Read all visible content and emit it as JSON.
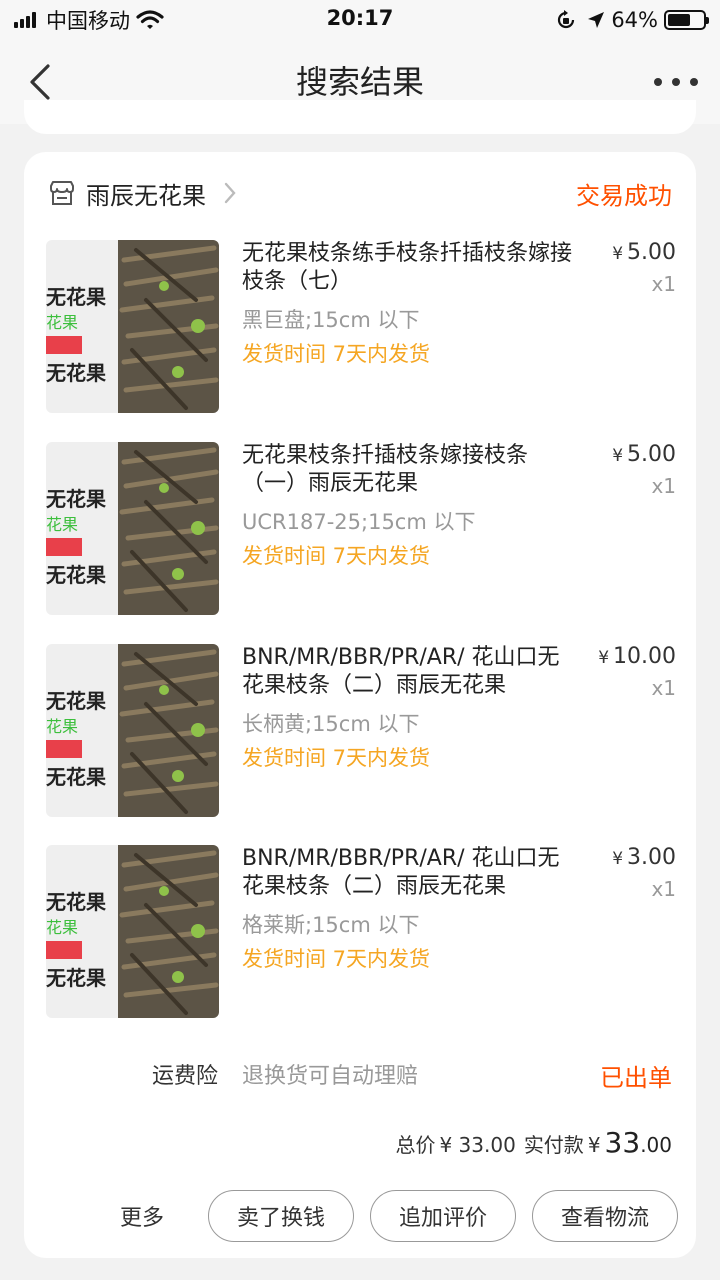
{
  "status_bar": {
    "carrier": "中国移动",
    "time": "20:17",
    "battery_percent": "64%",
    "battery_level": 0.64,
    "icons": [
      "signal-icon",
      "wifi-icon",
      "orientation-lock-icon",
      "location-icon",
      "battery-icon"
    ]
  },
  "nav": {
    "title": "搜索结果",
    "back_icon": "chevron-left-icon",
    "more_icon": "more-dots-icon"
  },
  "order": {
    "shop_name": "雨辰无花果",
    "shop_icon": "store-icon",
    "status": "交易成功",
    "items": [
      {
        "title": "无花果枝条练手枝条扦插枝条嫁接枝条（七）",
        "spec": "黑巨盘;15cm 以下",
        "shipping": "发货时间 7天内发货",
        "currency": "¥",
        "price": "5.00",
        "qty": "x1"
      },
      {
        "title": "无花果枝条扦插枝条嫁接枝条（一）雨辰无花果",
        "spec": "UCR187-25;15cm 以下",
        "shipping": "发货时间 7天内发货",
        "currency": "¥",
        "price": "5.00",
        "qty": "x1"
      },
      {
        "title": "BNR/MR/BBR/PR/AR/ 花山口无花果枝条（二）雨辰无花果",
        "spec": "长柄黄;15cm 以下",
        "shipping": "发货时间 7天内发货",
        "currency": "¥",
        "price": "10.00",
        "qty": "x1"
      },
      {
        "title": "BNR/MR/BBR/PR/AR/ 花山口无花果枝条（二）雨辰无花果",
        "spec": "格莱斯;15cm 以下",
        "shipping": "发货时间 7天内发货",
        "currency": "¥",
        "price": "3.00",
        "qty": "x1"
      }
    ],
    "thumb_text": {
      "line1": "无花果",
      "line2": "花果",
      "line3": "无花果"
    },
    "insurance": {
      "label": "运费险",
      "desc": "退换货可自动理赔",
      "status": "已出单"
    },
    "totals": {
      "total_label": "总价",
      "currency": "¥",
      "total_value": "33.00",
      "paid_label": "实付款",
      "paid_int": "33",
      "paid_dec": ".00"
    },
    "actions": {
      "more": "更多",
      "sell": "卖了换钱",
      "review": "追加评价",
      "logistics": "查看物流"
    }
  },
  "colors": {
    "accent": "#ff5000",
    "shipping": "#f5a623",
    "muted": "#999999",
    "background": "#f2f2f2"
  }
}
